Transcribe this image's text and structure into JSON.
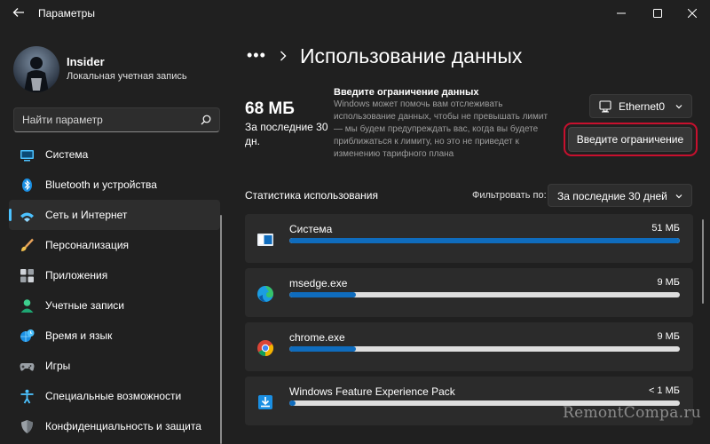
{
  "window": {
    "title": "Параметры"
  },
  "user": {
    "name": "Insider",
    "account_type": "Локальная учетная запись"
  },
  "search": {
    "placeholder": "Найти параметр"
  },
  "sidebar": {
    "items": [
      {
        "label": "Система",
        "icon": "system-icon"
      },
      {
        "label": "Bluetooth и устройства",
        "icon": "bluetooth-icon"
      },
      {
        "label": "Сеть и Интернет",
        "icon": "network-icon",
        "selected": true
      },
      {
        "label": "Персонализация",
        "icon": "brush-icon"
      },
      {
        "label": "Приложения",
        "icon": "apps-icon"
      },
      {
        "label": "Учетные записи",
        "icon": "accounts-icon"
      },
      {
        "label": "Время и язык",
        "icon": "time-language-icon"
      },
      {
        "label": "Игры",
        "icon": "gamepad-icon"
      },
      {
        "label": "Специальные возможности",
        "icon": "accessibility-icon"
      },
      {
        "label": "Конфиденциальность и защита",
        "icon": "shield-icon"
      }
    ]
  },
  "breadcrumb": {
    "more": "•••",
    "title": "Использование данных"
  },
  "summary": {
    "total": "68 МБ",
    "period_text": "За последние 30 дн.",
    "limit_title": "Введите ограничение данных",
    "limit_description": "Windows может помочь вам отслеживать использование данных, чтобы не превышать лимит — мы будем предупреждать вас, когда вы будете приближаться к лимиту, но это не приведет к изменению тарифного плана",
    "limit_button": "Введите ограничение"
  },
  "network_selector": {
    "value": "Ethernet0"
  },
  "stats": {
    "title": "Статистика использования",
    "filter_label": "Фильтровать по:",
    "period_value": "За последние 30 дней",
    "apps": [
      {
        "name": "Система",
        "usage": "51 МБ",
        "fraction": 1.0,
        "icon": "system-app-icon"
      },
      {
        "name": "msedge.exe",
        "usage": "9 МБ",
        "fraction": 0.17,
        "icon": "edge-icon"
      },
      {
        "name": "chrome.exe",
        "usage": "9 МБ",
        "fraction": 0.17,
        "icon": "chrome-icon"
      },
      {
        "name": "Windows Feature Experience Pack",
        "usage": "< 1 МБ",
        "fraction": 0.01,
        "icon": "feature-pack-icon"
      }
    ]
  },
  "watermark": "RemontCompa.ru",
  "colors": {
    "accent": "#4cc2ff",
    "bar_fill": "#0f6cbd",
    "highlight_ring": "#c8102e"
  }
}
